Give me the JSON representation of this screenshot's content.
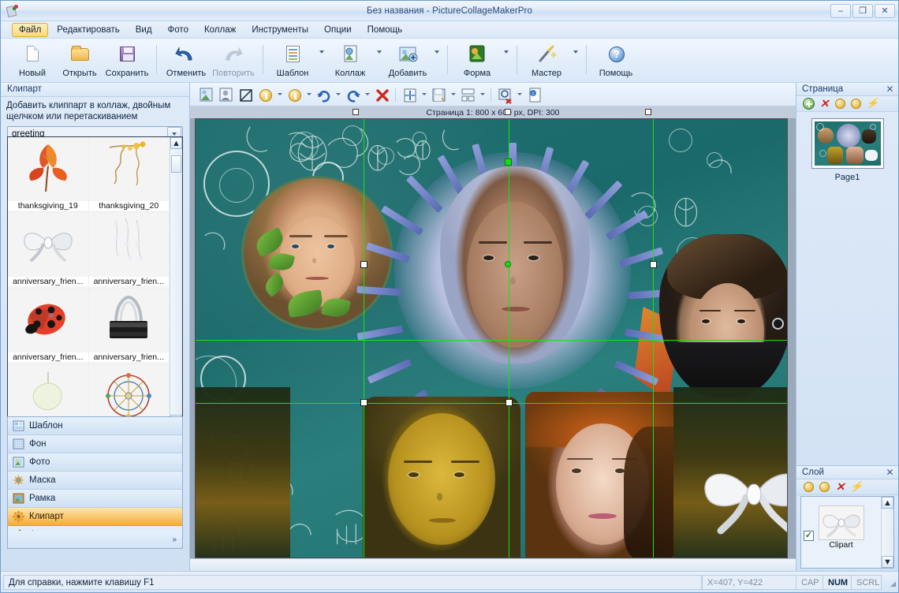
{
  "window": {
    "title": "Без названия - PictureCollageMakerPro",
    "icon": "app-icon",
    "minimize": "–",
    "maximize": "❐",
    "close": "✕"
  },
  "menubar": {
    "items": [
      {
        "label": "Файл",
        "active": true
      },
      {
        "label": "Редактировать",
        "active": false
      },
      {
        "label": "Вид",
        "active": false
      },
      {
        "label": "Фото",
        "active": false
      },
      {
        "label": "Коллаж",
        "active": false
      },
      {
        "label": "Инструменты",
        "active": false
      },
      {
        "label": "Опции",
        "active": false
      },
      {
        "label": "Помощь",
        "active": false
      }
    ]
  },
  "toolbar": {
    "buttons": [
      {
        "label": "Новый",
        "icon": "new-page-icon",
        "dropdown": false,
        "disabled": false
      },
      {
        "label": "Открыть",
        "icon": "open-folder-icon",
        "dropdown": false,
        "disabled": false
      },
      {
        "label": "Сохранить",
        "icon": "save-diskette-icon",
        "dropdown": false,
        "disabled": false
      },
      {
        "label": "Отменить",
        "icon": "undo-arrow-icon",
        "dropdown": false,
        "disabled": false
      },
      {
        "label": "Повторить",
        "icon": "redo-arrow-icon",
        "dropdown": false,
        "disabled": true
      },
      {
        "label": "Шаблон",
        "icon": "template-icon",
        "dropdown": true,
        "disabled": false
      },
      {
        "label": "Коллаж",
        "icon": "collage-icon",
        "dropdown": true,
        "disabled": false
      },
      {
        "label": "Добавить",
        "icon": "add-photo-icon",
        "dropdown": true,
        "disabled": false
      },
      {
        "label": "Форма",
        "icon": "shape-icon",
        "dropdown": true,
        "disabled": false
      },
      {
        "label": "Мастер",
        "icon": "magic-wand-icon",
        "dropdown": true,
        "disabled": false
      },
      {
        "label": "Помощь",
        "icon": "help-question-icon",
        "dropdown": false,
        "disabled": false
      }
    ]
  },
  "toolbar2": {
    "buttons": [
      {
        "name": "insert-photo-icon",
        "dropdown": false
      },
      {
        "name": "replace-photo-icon",
        "dropdown": false
      },
      {
        "name": "crop-icon",
        "dropdown": false
      },
      {
        "name": "bring-forward-coin-icon",
        "dropdown": true
      },
      {
        "name": "send-backward-coin-icon",
        "dropdown": true
      },
      {
        "name": "rotate-right-icon",
        "dropdown": true
      },
      {
        "name": "rotate-left-icon",
        "dropdown": true
      },
      {
        "name": "delete-x-icon",
        "dropdown": false
      },
      {
        "name": "align-vertical-icon",
        "dropdown": true
      },
      {
        "name": "save-layout-icon",
        "dropdown": true
      },
      {
        "name": "distribute-icon",
        "dropdown": true
      },
      {
        "name": "zoom-select-icon",
        "dropdown": true
      },
      {
        "name": "properties-info-icon",
        "dropdown": false
      }
    ]
  },
  "clipart_panel": {
    "title": "Клипарт",
    "hint": "Добавить клиппарт в коллаж, двойным щелчком или перетаскиванием",
    "category_value": "greeting",
    "category_placeholder": "greeting",
    "items": [
      {
        "name": "thanksgiving_19",
        "thumb": "autumn-leaves-clipart"
      },
      {
        "name": "thanksgiving_20",
        "thumb": "berry-branch-clipart"
      },
      {
        "name": "anniversary_frien...",
        "thumb": "white-bow-clipart"
      },
      {
        "name": "anniversary_frien...",
        "thumb": "pearl-strands-clipart"
      },
      {
        "name": "anniversary_frien...",
        "thumb": "ladybug-clipart"
      },
      {
        "name": "anniversary_frien...",
        "thumb": "binder-clip-clipart"
      },
      {
        "name": "",
        "thumb": "pale-leaf-clipart"
      },
      {
        "name": "",
        "thumb": "ferris-wheel-clipart"
      }
    ],
    "scroll_up": "▲",
    "scroll_down": "▼"
  },
  "categories": {
    "items": [
      {
        "label": "Шаблон",
        "icon": "template-cat-icon",
        "selected": false
      },
      {
        "label": "Фон",
        "icon": "background-cat-icon",
        "selected": false
      },
      {
        "label": "Фото",
        "icon": "photo-cat-icon",
        "selected": false
      },
      {
        "label": "Маска",
        "icon": "mask-cat-icon",
        "selected": false
      },
      {
        "label": "Рамка",
        "icon": "frame-cat-icon",
        "selected": false
      },
      {
        "label": "Клипарт",
        "icon": "clipart-cat-icon",
        "selected": true
      },
      {
        "label": "Форма",
        "icon": "shape-cat-icon",
        "selected": false
      }
    ],
    "expand": "»"
  },
  "canvas": {
    "header": "Страница 1: 800 x 600 px, DPI: 300",
    "background_color": "#1d6e6e",
    "selection_color": "#18e018"
  },
  "page_panel": {
    "title": "Страница",
    "close": "✕",
    "tools": [
      "add-page-icon",
      "delete-page-icon",
      "move-up-icon",
      "move-down-icon",
      "refresh-icon"
    ],
    "pages": [
      {
        "label": "Page1"
      }
    ]
  },
  "layer_panel": {
    "title": "Слой",
    "close": "✕",
    "tools": [
      "layer-up-icon",
      "layer-down-icon",
      "delete-layer-icon",
      "refresh-layer-icon"
    ],
    "layers": [
      {
        "label": "Clipart",
        "visible": true,
        "check": "✓",
        "thumb": "white-bow-layer"
      }
    ],
    "scroll_up": "▲",
    "scroll_down": "▼"
  },
  "statusbar": {
    "message": "Для справки, нажмите клавишу F1",
    "coordinates": "X=407, Y=422",
    "indicators": [
      {
        "label": "CAP",
        "on": false
      },
      {
        "label": "NUM",
        "on": true
      },
      {
        "label": "SCRL",
        "on": false
      }
    ],
    "grip": "◢"
  }
}
